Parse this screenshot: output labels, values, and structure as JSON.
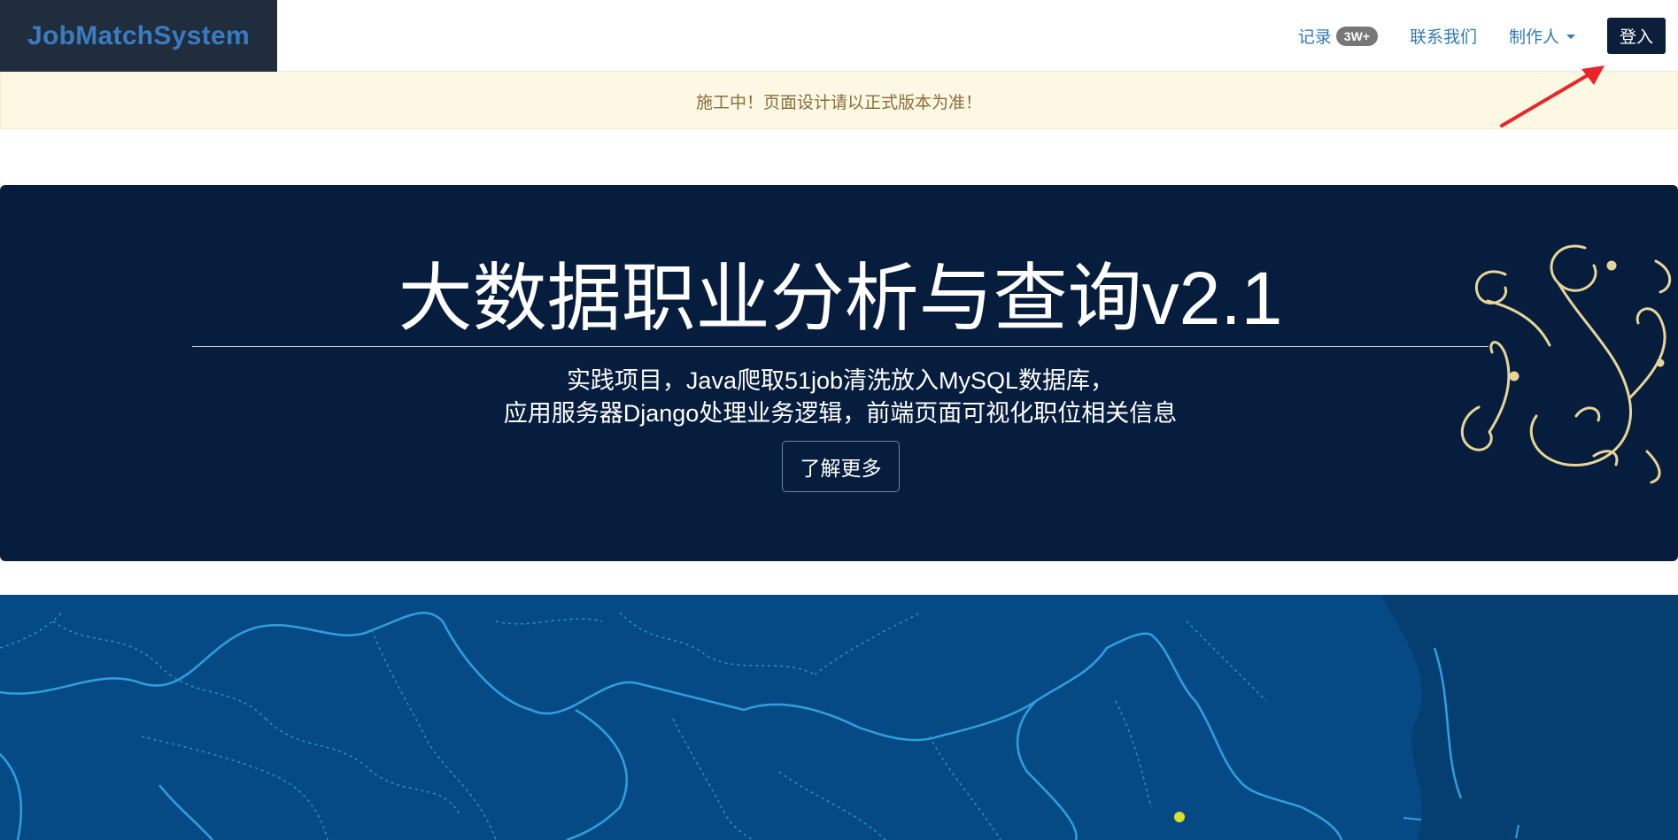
{
  "navbar": {
    "brand": "JobMatchSystem",
    "records_label": "记录",
    "records_badge": "3W+",
    "contact_label": "联系我们",
    "author_label": "制作人",
    "login_label": "登入"
  },
  "alert": {
    "text": "施工中！页面设计请以正式版本为准！"
  },
  "jumbotron": {
    "title": "大数据职业分析与查询v2.1",
    "line1": "实践项目，Java爬取51job清洗放入MySQL数据库，",
    "line2": "应用服务器Django处理业务逻辑，前端页面可视化职位相关信息",
    "button_label": "了解更多"
  },
  "colors": {
    "brand_bg": "#1f2d3d",
    "brand_text": "#3b7bbf",
    "link": "#337ab7",
    "login_bg": "#0b1f3a",
    "jumbotron_bg": "#071d3e",
    "map_bg": "#064a85",
    "ornament": "#e6d596",
    "annotation_arrow": "#e8262a"
  },
  "icons": {
    "author_dropdown": "caret-down-icon",
    "annotation": "red-arrow-icon",
    "decoration": "flourish-ornament-icon",
    "map_marker": "yellow-dot-marker"
  }
}
